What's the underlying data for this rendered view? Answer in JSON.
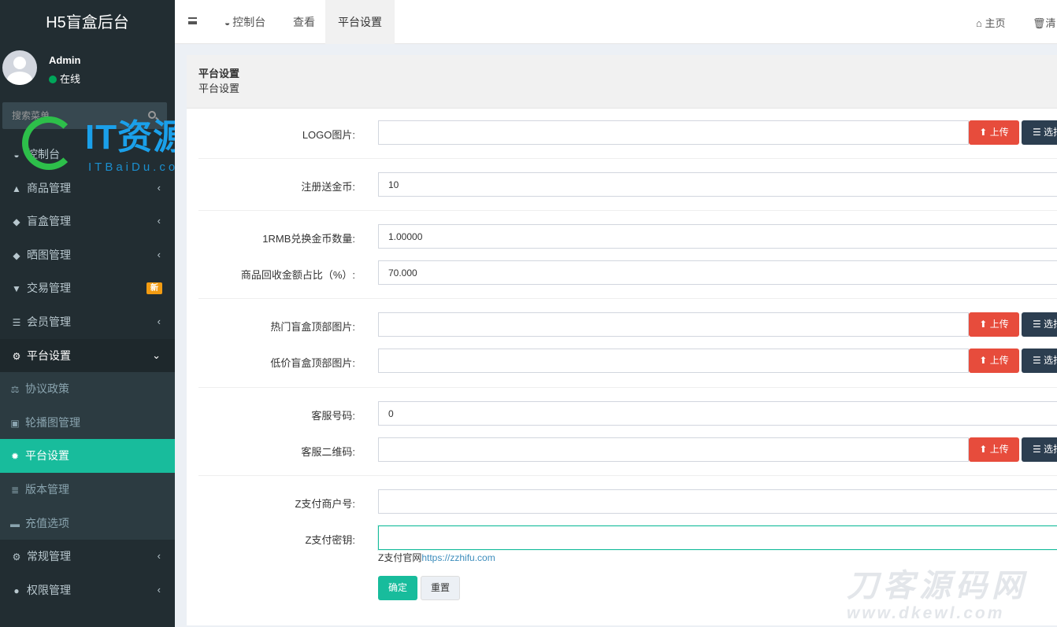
{
  "app": {
    "title": "H5盲盒后台"
  },
  "user": {
    "name": "Admin",
    "status": "在线"
  },
  "search": {
    "placeholder": "搜索菜单"
  },
  "menu": [
    {
      "label": "控制台",
      "icon": "dashboard-icon"
    },
    {
      "label": "商品管理",
      "icon": "shopping-bag-icon"
    },
    {
      "label": "盲盒管理",
      "icon": "dropbox-icon"
    },
    {
      "label": "晒图管理",
      "icon": "dropbox-icon"
    },
    {
      "label": "交易管理",
      "icon": "shopping-cart-icon",
      "badge": "新"
    },
    {
      "label": "会员管理",
      "icon": "list-icon"
    },
    {
      "label": "平台设置",
      "icon": "cogs-icon",
      "expanded": true
    },
    {
      "label": "协议政策",
      "icon": "balance-scale-icon"
    },
    {
      "label": "轮播图管理",
      "icon": "image-icon"
    },
    {
      "label": "平台设置",
      "icon": "cog-icon",
      "active": true
    },
    {
      "label": "版本管理",
      "icon": "server-icon"
    },
    {
      "label": "充值选项",
      "icon": "battery-icon"
    },
    {
      "label": "常规管理",
      "icon": "cogs-icon"
    },
    {
      "label": "权限管理",
      "icon": "users-icon"
    }
  ],
  "topbar": {
    "tabs": [
      {
        "label": "控制台",
        "icon": "dashboard-icon"
      },
      {
        "label": "查看"
      },
      {
        "label": "平台设置",
        "active": true
      }
    ],
    "home_label": "主页",
    "clear_label": "清除"
  },
  "panel": {
    "title": "平台设置",
    "subtitle": "平台设置"
  },
  "form": {
    "logo_label": "LOGO图片:",
    "logo_value": "",
    "register_coins_label": "注册送金币:",
    "register_coins_value": "10",
    "rmb_rate_label": "1RMB兑换金币数量:",
    "rmb_rate_value": "1.00000",
    "recycle_label": "商品回收金额占比（%）:",
    "recycle_value": "70.000",
    "hot_banner_label": "热门盲盒顶部图片:",
    "hot_banner_value": "",
    "low_banner_label": "低价盲盒顶部图片:",
    "low_banner_value": "",
    "service_no_label": "客服号码:",
    "service_no_value": "0",
    "service_qr_label": "客服二维码:",
    "service_qr_value": "",
    "zpay_id_label": "Z支付商户号:",
    "zpay_id_value": "",
    "zpay_key_label": "Z支付密钥:",
    "zpay_key_value": "",
    "upload_label": "上传",
    "select_label": "选择",
    "help_text": "Z支付官网",
    "help_link": "https://zzhifu.com",
    "submit_label": "确定",
    "reset_label": "重置"
  },
  "watermarks": {
    "it_name": "IT资源网",
    "it_domain": "ITBaiDu.com",
    "dk_name": "刀客源码网",
    "dk_domain": "www.dkewl.com"
  },
  "colors": {
    "sidebar": "#222d32",
    "accent": "#18bc9c",
    "danger": "#e74c3c",
    "dark": "#2c3e50",
    "badge": "#f39c12"
  }
}
